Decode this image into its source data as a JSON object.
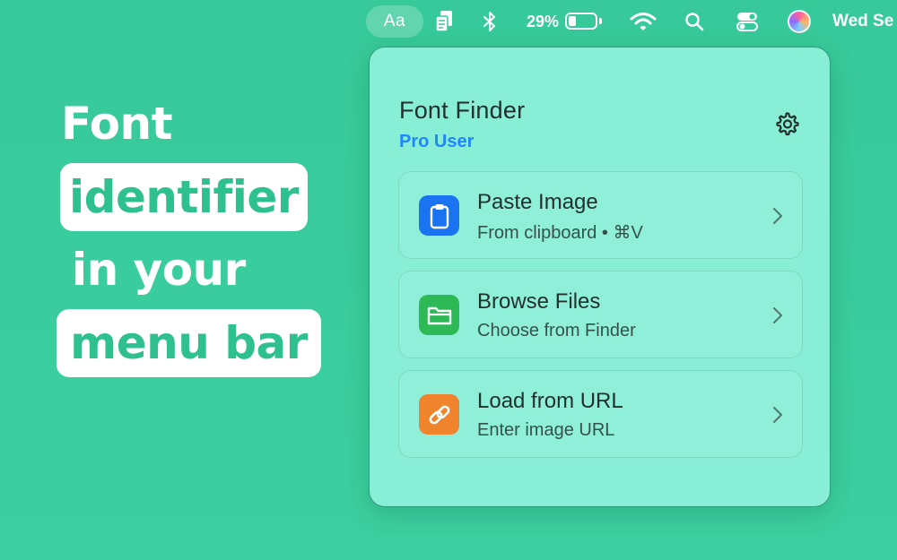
{
  "menubar": {
    "font_app_label": "Aa",
    "battery_percent": 29,
    "battery_label": "29%",
    "date_label": "Wed Se",
    "icons": [
      "font-finder-icon",
      "clipboard-app-icon",
      "bluetooth-icon",
      "battery-icon",
      "wifi-icon",
      "search-icon",
      "control-center-icon",
      "siri-icon"
    ]
  },
  "headline": {
    "line1": "Font",
    "line2": "identifier",
    "line3": "in your",
    "line4": "menu bar"
  },
  "panel": {
    "title": "Font Finder",
    "subtitle": "Pro User",
    "settings_icon": "gear-icon",
    "actions": [
      {
        "title": "Paste Image",
        "subtitle": "From clipboard • ⌘V",
        "icon": "clipboard-icon",
        "color": "#1a73f0"
      },
      {
        "title": "Browse Files",
        "subtitle": "Choose from Finder",
        "icon": "folder-icon",
        "color": "#2db955"
      },
      {
        "title": "Load from URL",
        "subtitle": "Enter image URL",
        "icon": "link-icon",
        "color": "#f0842c"
      }
    ]
  },
  "colors": {
    "background": "#3ccf9f",
    "panel": "#88eed6",
    "accent_blue": "#1f86ff",
    "headline_pill_text": "#2fc08f"
  }
}
